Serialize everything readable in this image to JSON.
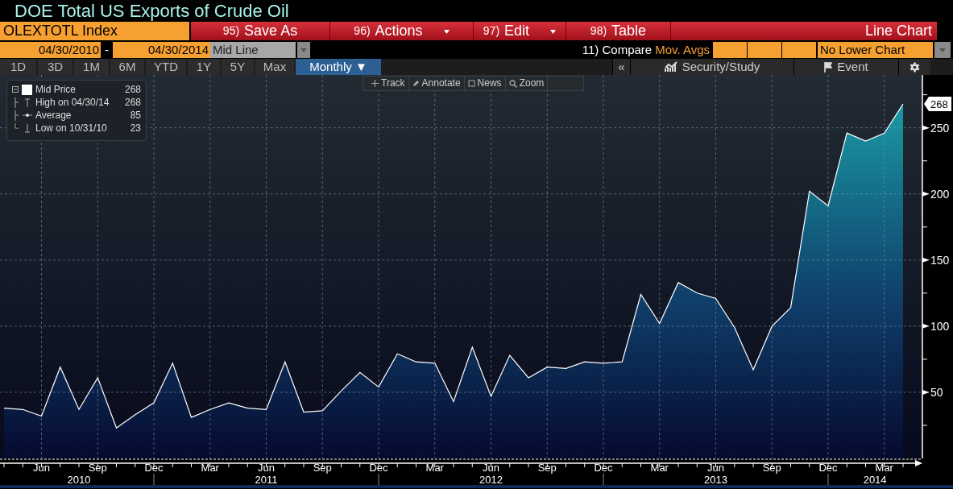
{
  "title": "DOE Total US Exports of Crude Oil",
  "security": "OLEXTOTL Index",
  "actions": [
    {
      "number": "95)",
      "label": "Save As",
      "dropdown": false
    },
    {
      "number": "96)",
      "label": "Actions",
      "dropdown": true
    },
    {
      "number": "97)",
      "label": "Edit",
      "dropdown": true
    },
    {
      "number": "98)",
      "label": "Table",
      "dropdown": false
    }
  ],
  "chart_type": "Line Chart",
  "date_from": "04/30/2010",
  "date_separator": "-",
  "date_to": "04/30/2014",
  "line_type": "Mid Line",
  "compare": {
    "number": "11)",
    "label": "Compare",
    "moving_averages": "Mov. Avgs"
  },
  "lower_chart": "No Lower Chart",
  "periods": [
    {
      "label": "1D",
      "selected": false
    },
    {
      "label": "3D",
      "selected": false
    },
    {
      "label": "1M",
      "selected": false
    },
    {
      "label": "6M",
      "selected": false
    },
    {
      "label": "YTD",
      "selected": false
    },
    {
      "label": "1Y",
      "selected": false
    },
    {
      "label": "5Y",
      "selected": false
    },
    {
      "label": "Max",
      "selected": false
    },
    {
      "label": "Monthly ▼",
      "selected": true
    }
  ],
  "right_tools": [
    {
      "kind": "collapse",
      "label": "«"
    },
    {
      "kind": "study",
      "label": "Security/Study"
    },
    {
      "kind": "event",
      "label": "Event"
    },
    {
      "kind": "settings"
    }
  ],
  "chart_tools": [
    "Track",
    "Annotate",
    "News",
    "Zoom"
  ],
  "legend": [
    {
      "label": "Mid Price",
      "value": "268"
    },
    {
      "label": "High on 04/30/14",
      "value": "268"
    },
    {
      "label": "Average",
      "value": "85"
    },
    {
      "label": "Low on 10/31/10",
      "value": "23"
    }
  ],
  "last_value_tag": "268",
  "year_labels": [
    "2010",
    "2011",
    "2012",
    "2013",
    "2014"
  ],
  "chart_data": {
    "type": "area",
    "grid": true,
    "categories": [
      null,
      null,
      "Jun",
      null,
      null,
      "Sep",
      null,
      null,
      "Dec",
      null,
      null,
      "Mar",
      null,
      null,
      "Jun",
      null,
      null,
      "Sep",
      null,
      null,
      "Dec",
      null,
      null,
      "Mar",
      null,
      null,
      "Jun",
      null,
      null,
      "Sep",
      null,
      null,
      "Dec",
      null,
      null,
      "Mar",
      null,
      null,
      "Jun",
      null,
      null,
      "Sep",
      null,
      null,
      "Dec",
      null,
      null,
      "Mar",
      null
    ],
    "series": [
      {
        "color": "#ffffff",
        "values": [
          38,
          37,
          32,
          69,
          37,
          61,
          23,
          33,
          42,
          72,
          31,
          37,
          42,
          38,
          37,
          73,
          35,
          36,
          51,
          65,
          54,
          79,
          73,
          72,
          43,
          84,
          47,
          78,
          61,
          69,
          68,
          73,
          72,
          73,
          124,
          102,
          133,
          125,
          121,
          99,
          67,
          100,
          114,
          202,
          191,
          246,
          240,
          246,
          268
        ]
      }
    ],
    "ylim": [
      0,
      290
    ],
    "yticks": [
      50,
      100,
      150,
      200,
      250
    ]
  }
}
